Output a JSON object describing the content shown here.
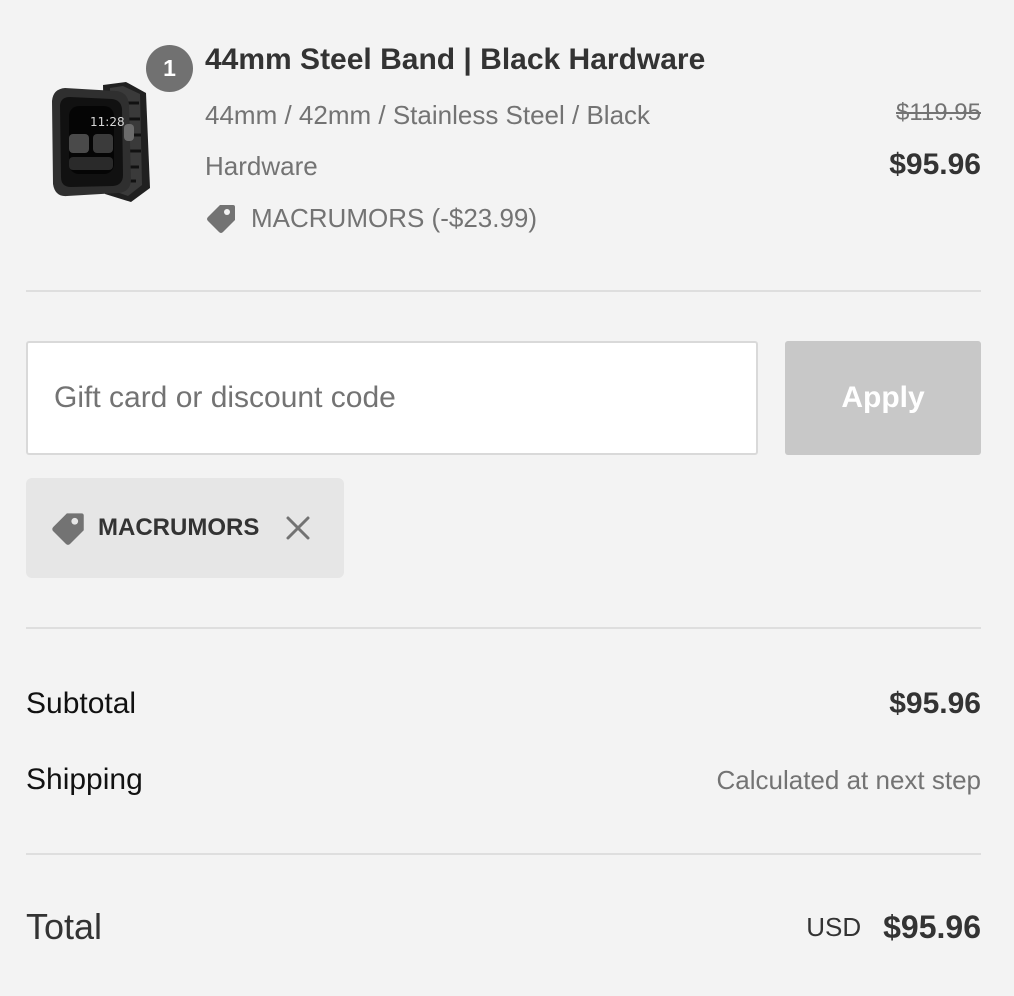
{
  "order_summary": {
    "product": {
      "quantity": "1",
      "title": "44mm Steel Band | Black Hardware",
      "variant": "44mm / 42mm / Stainless Steel / Black Hardware",
      "discount_text": "MACRUMORS (-$23.99)",
      "original_price": "$119.95",
      "price": "$95.96",
      "image_icon": "watch-product-icon",
      "tag_icon": "price-tag-icon"
    },
    "discount_form": {
      "placeholder": "Gift card or discount code",
      "value": "",
      "apply_label": "Apply"
    },
    "applied_code": {
      "label": "MACRUMORS",
      "tag_icon": "price-tag-icon",
      "remove_icon": "close-icon"
    },
    "subtotal": {
      "label": "Subtotal",
      "value": "$95.96"
    },
    "shipping": {
      "label": "Shipping",
      "value": "Calculated at next step"
    },
    "total": {
      "label": "Total",
      "currency": "USD",
      "value": "$95.96"
    },
    "colors": {
      "background": "#f3f3f3",
      "button_disabled": "#c8c8c8",
      "chip_background": "#e6e6e6",
      "badge": "#717171",
      "muted_text": "#737373",
      "primary_text": "#333333"
    }
  }
}
